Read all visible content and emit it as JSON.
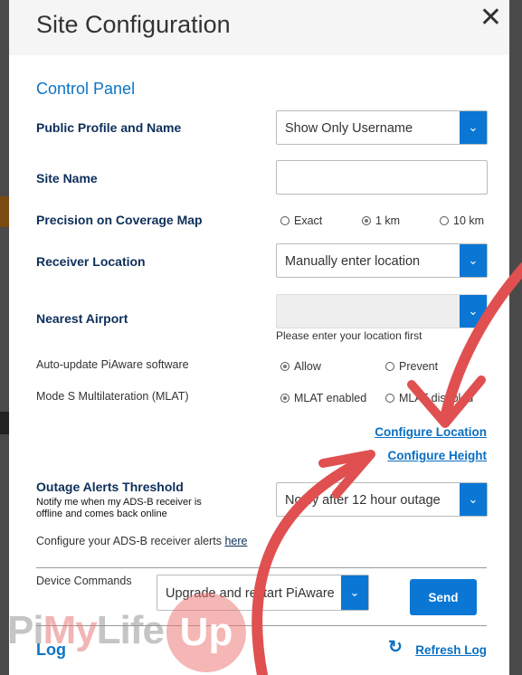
{
  "modal": {
    "title": "Site Configuration",
    "close_icon": "close-icon",
    "section_title": "Control Panel",
    "public_profile": {
      "label": "Public Profile and Name",
      "value": "Show Only Username"
    },
    "site_name": {
      "label": "Site Name",
      "value": ""
    },
    "precision": {
      "label": "Precision on Coverage Map",
      "options": [
        "Exact",
        "1 km",
        "10 km"
      ],
      "selected": "1 km"
    },
    "receiver_location": {
      "label": "Receiver Location",
      "value": "Manually enter location"
    },
    "nearest_airport": {
      "label": "Nearest Airport",
      "value": "",
      "hint": "Please enter your location first"
    },
    "auto_update": {
      "label": "Auto-update PiAware software",
      "options": [
        "Allow",
        "Prevent"
      ],
      "selected": "Allow"
    },
    "mlat": {
      "label": "Mode S Multilateration (MLAT)",
      "options": [
        "MLAT enabled",
        "MLAT disabled"
      ],
      "selected": "MLAT enabled"
    },
    "configure_location": "Configure Location",
    "configure_height": "Configure Height",
    "outage": {
      "label": "Outage Alerts Threshold",
      "description": "Notify me when my ADS-B receiver is offline and comes back online",
      "value": "Notify after 12 hour outage"
    },
    "alerts_text": "Configure your ADS-B receiver alerts",
    "alerts_link": "here",
    "device_commands": {
      "label": "Device Commands",
      "value": "Upgrade and restart PiAware",
      "send": "Send"
    },
    "log_title": "Log",
    "refresh_log": "Refresh Log"
  },
  "watermark": "PiMyLifeUp",
  "colors": {
    "accent": "#0a77d5",
    "annotation": "#e05050"
  }
}
